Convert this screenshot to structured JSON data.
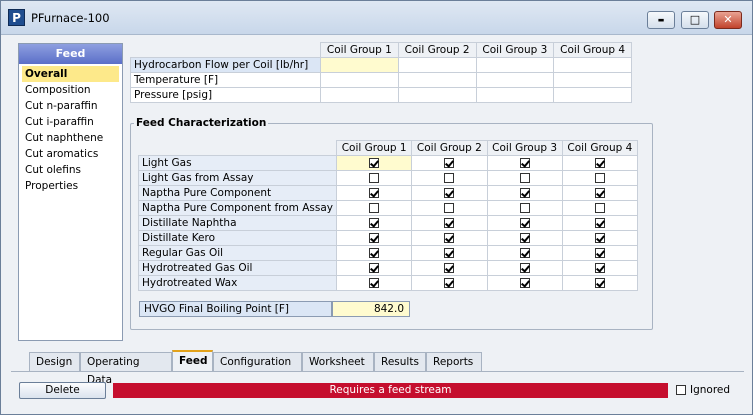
{
  "window": {
    "title": "PFurnace-100",
    "app_icon_letter": "P"
  },
  "window_controls": {
    "minimize": "▬",
    "maximize": "□",
    "close": "✕"
  },
  "sidebar": {
    "header": "Feed",
    "items": [
      "Overall",
      "Composition",
      "Cut n-paraffin",
      "Cut i-paraffin",
      "Cut naphthene",
      "Cut aromatics",
      "Cut olefins",
      "Properties"
    ],
    "active_index": 0
  },
  "columns": [
    "Coil Group 1",
    "Coil Group 2",
    "Coil Group 3",
    "Coil Group 4"
  ],
  "top_table": {
    "rows": [
      "Hydrocarbon Flow per Coil [lb/hr]",
      "Temperature [F]",
      "Pressure [psig]"
    ]
  },
  "feed_characterization": {
    "title": "Feed Characterization",
    "rows": [
      {
        "label": "Light Gas",
        "checks": [
          true,
          true,
          true,
          true
        ]
      },
      {
        "label": "Light Gas from Assay",
        "checks": [
          false,
          false,
          false,
          false
        ]
      },
      {
        "label": "Naptha Pure Component",
        "checks": [
          true,
          true,
          true,
          true
        ]
      },
      {
        "label": "Naptha Pure Component from Assay",
        "checks": [
          false,
          false,
          false,
          false
        ]
      },
      {
        "label": "Distillate Naphtha",
        "checks": [
          true,
          true,
          true,
          true
        ]
      },
      {
        "label": "Distillate Kero",
        "checks": [
          true,
          true,
          true,
          true
        ]
      },
      {
        "label": "Regular Gas Oil",
        "checks": [
          true,
          true,
          true,
          true
        ]
      },
      {
        "label": "Hydrotreated Gas Oil",
        "checks": [
          true,
          true,
          true,
          true
        ]
      },
      {
        "label": "Hydrotreated Wax",
        "checks": [
          true,
          true,
          true,
          true
        ]
      }
    ]
  },
  "hvgo": {
    "label": "HVGO Final Boiling Point [F]",
    "value": "842.0"
  },
  "tabs": {
    "items": [
      "Design",
      "Operating Data",
      "Feed",
      "Configuration",
      "Worksheet",
      "Results",
      "Reports"
    ],
    "active_index": 2
  },
  "footer": {
    "delete_label": "Delete",
    "status_text": "Requires a feed stream",
    "ignored_label": "Ignored",
    "ignored_checked": false
  }
}
